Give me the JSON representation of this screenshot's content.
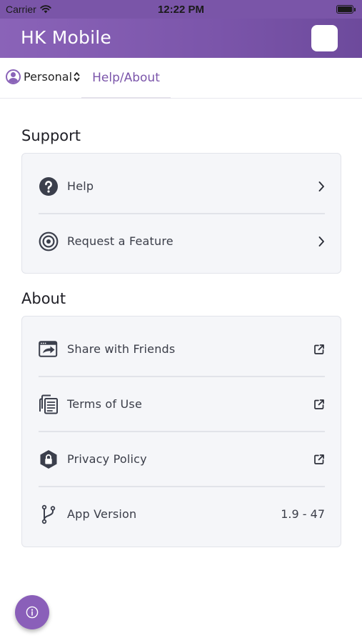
{
  "status_bar": {
    "carrier": "Carrier",
    "time": "12:22 PM",
    "icons": [
      "wifi-icon",
      "battery-icon"
    ]
  },
  "header": {
    "title": "HK Mobile",
    "brand_color": "#7b55aa"
  },
  "tabs": {
    "account": {
      "label": "Personal",
      "icon": "avatar-icon"
    },
    "active_tab": {
      "label": "Help/About"
    }
  },
  "support": {
    "title": "Support",
    "items": [
      {
        "label": "Help",
        "icon": "question-circle-icon",
        "trailing": "chevron-right-icon"
      },
      {
        "label": "Request a Feature",
        "icon": "target-icon",
        "trailing": "chevron-right-icon"
      }
    ]
  },
  "about": {
    "title": "About",
    "items": [
      {
        "label": "Share with Friends",
        "icon": "share-window-icon",
        "trailing": "external-link-icon"
      },
      {
        "label": "Terms of Use",
        "icon": "documents-icon",
        "trailing": "external-link-icon"
      },
      {
        "label": "Privacy Policy",
        "icon": "shield-lock-icon",
        "trailing": "external-link-icon"
      },
      {
        "label": "App Version",
        "icon": "branch-icon",
        "value": "1.9 - 47"
      }
    ]
  },
  "fab": {
    "icon": "info-icon",
    "color": "#8a5fb9"
  }
}
